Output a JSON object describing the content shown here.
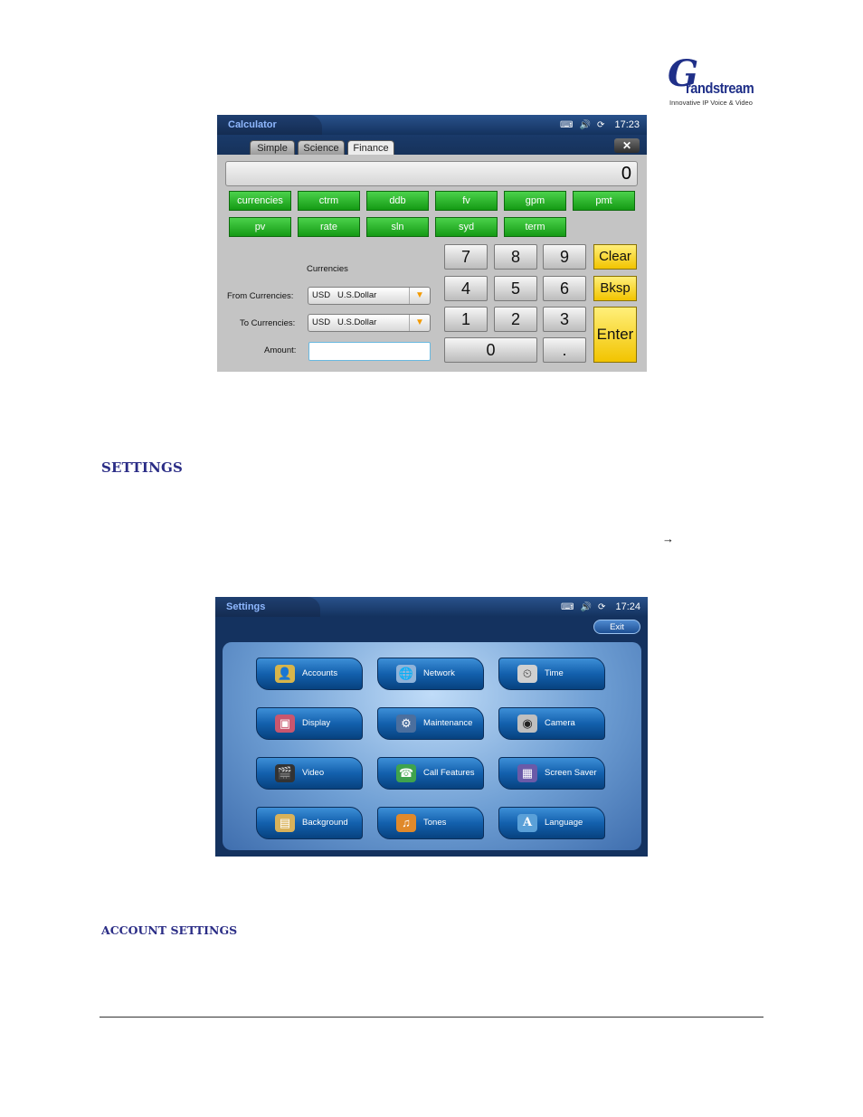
{
  "logo": {
    "mark": "G",
    "wordmark": "randstream",
    "tagline": "Innovative IP Voice & Video",
    "color": "#1f2f88"
  },
  "calculator": {
    "title": "Calculator",
    "time": "17:23",
    "tabs": [
      "Simple",
      "Science",
      "Finance"
    ],
    "active_tab": "Finance",
    "close_label": "✕",
    "display_value": "0",
    "functions": [
      "currencies",
      "ctrm",
      "ddb",
      "fv",
      "gpm",
      "pmt",
      "pv",
      "rate",
      "sln",
      "syd",
      "term"
    ],
    "keys": {
      "k7": "7",
      "k8": "8",
      "k9": "9",
      "k4": "4",
      "k5": "5",
      "k6": "6",
      "k1": "1",
      "k2": "2",
      "k3": "3",
      "k0": "0",
      "kdot": "."
    },
    "clear_label": "Clear",
    "bksp_label": "Bksp",
    "enter_label": "Enter",
    "form": {
      "heading": "Currencies",
      "from_label": "From Currencies:",
      "from_value": "USD   U.S.Dollar",
      "to_label": "To Currencies:",
      "to_value": "USD   U.S.Dollar",
      "amount_label": "Amount:",
      "amount_value": ""
    }
  },
  "headings": {
    "settings": "SETTINGS",
    "account_settings": "ACCOUNT SETTINGS",
    "arrow": "→"
  },
  "settings_screen": {
    "title": "Settings",
    "time": "17:24",
    "exit_label": "Exit",
    "buttons": [
      {
        "label": "Accounts",
        "icon": "accounts-icon"
      },
      {
        "label": "Network",
        "icon": "network-icon"
      },
      {
        "label": "Time",
        "icon": "time-icon"
      },
      {
        "label": "Display",
        "icon": "display-icon"
      },
      {
        "label": "Maintenance",
        "icon": "maintenance-icon"
      },
      {
        "label": "Camera",
        "icon": "camera-icon"
      },
      {
        "label": "Video",
        "icon": "video-icon"
      },
      {
        "label": "Call Features",
        "icon": "call-features-icon"
      },
      {
        "label": "Screen Saver",
        "icon": "screen-saver-icon"
      },
      {
        "label": "Background",
        "icon": "background-icon"
      },
      {
        "label": "Tones",
        "icon": "tones-icon"
      },
      {
        "label": "Language",
        "icon": "language-icon"
      }
    ]
  },
  "colors": {
    "heading": "#2b2d86",
    "calc_green": "#1fae1f",
    "calc_yellow": "#f7d51a",
    "screen_blue": "#14325f"
  }
}
